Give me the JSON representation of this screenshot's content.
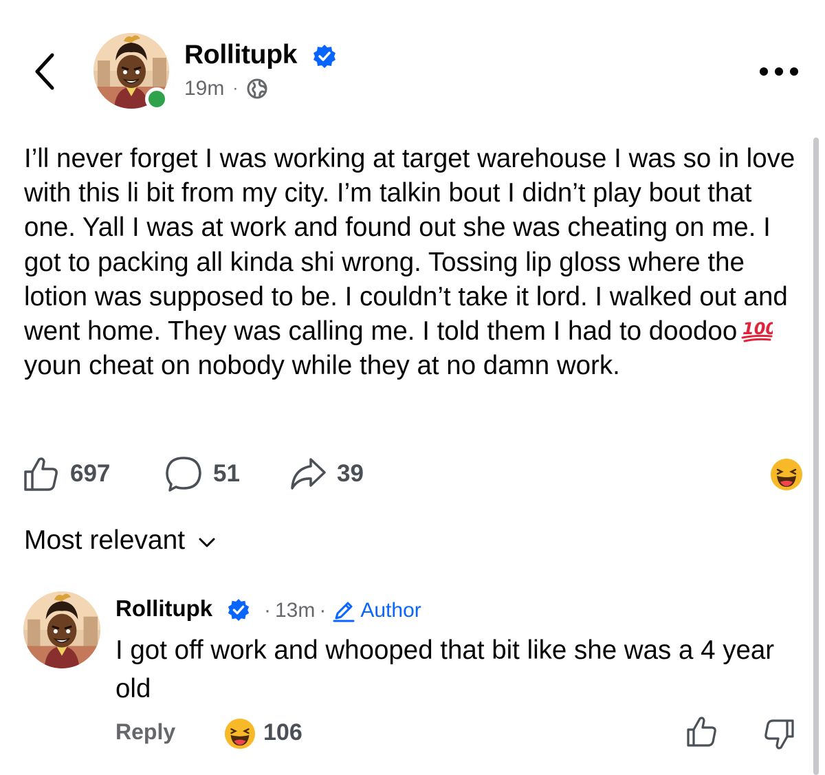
{
  "header": {
    "back_icon": "chevron-left-icon",
    "author_name": "Rollitupk",
    "verified_icon": "verified-badge-icon",
    "time": "19m",
    "separator": "·",
    "privacy_icon": "globe-icon",
    "more_icon": "more-horizontal-icon",
    "online_color": "#31a24c"
  },
  "post": {
    "text_before_emoji": "I’ll never forget I was working at target warehouse I was so in love with this li bit from my city. I’m talkin bout I didn’t play bout that one. Yall I was at work and found out she was cheating on me. I got to packing all kinda shi wrong. Tossing lip gloss where the lotion was supposed to be. I couldn’t take it lord. I walked out and went home. They was calling me. I told them I had to doodoo",
    "emoji": "hundred-points-emoji",
    "text_after_emoji": "youn cheat on nobody while they at no damn work."
  },
  "actions": {
    "likes": "697",
    "comments": "51",
    "shares": "39",
    "like_icon": "thumbs-up-icon",
    "comment_icon": "comment-bubble-icon",
    "share_icon": "share-arrow-icon",
    "reaction_icon": "haha-reaction-icon"
  },
  "sort": {
    "label": "Most relevant",
    "icon": "chevron-down-icon"
  },
  "comment": {
    "author_name": "Rollitupk",
    "time": "13m",
    "dot": "·",
    "author_badge": "Author",
    "author_badge_icon": "pencil-icon",
    "text": "I got off work and whooped that bit like she was a 4 year old",
    "reply_label": "Reply",
    "reaction_icon": "haha-reaction-icon",
    "reaction_count": "106",
    "like_icon": "thumbs-up-icon",
    "dislike_icon": "thumbs-down-icon"
  },
  "colors": {
    "accent": "#0866ff",
    "secondary_text": "#65676b",
    "primary_text": "#050505"
  }
}
